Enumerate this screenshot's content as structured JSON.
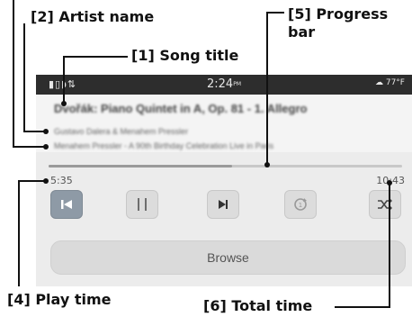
{
  "callouts": {
    "artist": "[2] Artist name",
    "title": "[1] Song title",
    "progress_line1": "[5] Progress",
    "progress_line2": "bar",
    "play_time": "[4] Play time",
    "total_time": "[6] Total time"
  },
  "status_bar": {
    "time": "2:24",
    "ampm": "PM",
    "weather": "77°F"
  },
  "track": {
    "title": "Dvořák: Piano Quintet in A, Op. 81 - 1. Allegro",
    "artist": "Gustavo Dalera & Menahem Pressler",
    "album": "Menahem Pressler - A 90th Birthday Celebration Live in Paris"
  },
  "playback": {
    "play_time": "5:35",
    "total_time": "10:43",
    "progress": 0.52
  },
  "controls": {
    "browse_label": "Browse"
  },
  "colors": {
    "screen_bg": "#ececec",
    "status_bar_bg": "#2d2d2d",
    "active_button": "#8e9aa6"
  },
  "icons": [
    "previous-icon",
    "pause-icon",
    "next-icon",
    "repeat-icon",
    "shuffle-icon"
  ]
}
